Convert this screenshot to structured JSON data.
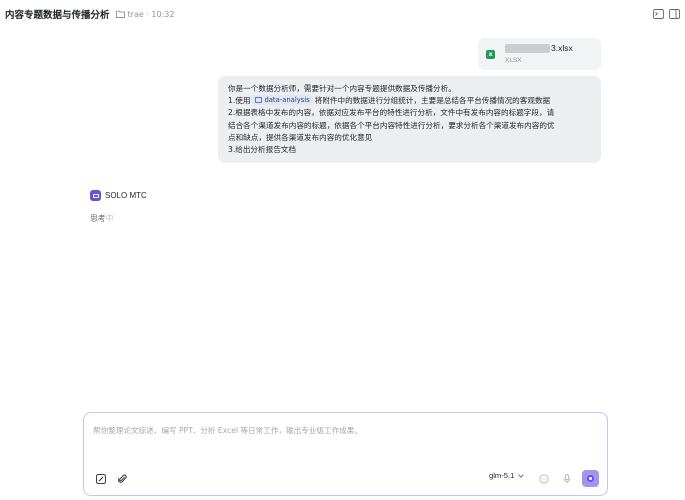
{
  "header": {
    "title": "内容专题数据与传播分析",
    "project": "trae",
    "time": "10:32",
    "project_meta": "trae · 10:32"
  },
  "attachment": {
    "name": "3.xlsx",
    "type": "XLSX",
    "icon": "excel-file-icon"
  },
  "user_message": {
    "line1": "你是一个数据分析师，需要针对一个内容专题提供数据及传播分析。",
    "line2_prefix": "1.使用",
    "skill_chip": "data-analysis",
    "line2_suffix": "将附件中的数据进行分组统计，主要是总结各平台传播情况的客观数据",
    "line3": "2.根据表格中发布的内容，依据对应发布平台的特性进行分析，文件中有发布内容的标题字段，请",
    "line4": "结合各个渠道发布内容的标题，依据各个平台内容特性进行分析，要求分析各个渠道发布内容的优",
    "line5": "点和缺点，提供各渠道发布内容的优化意见",
    "line6": "3.给出分析报告文档"
  },
  "assistant": {
    "name": "SOLO MTC",
    "status_main": "思考",
    "status_dim": "中"
  },
  "composer": {
    "placeholder": "帮你整理论文综述、编写 PPT、分析 Excel 等日常工作，输出专业级工作成果。",
    "model": "glm-5.1"
  },
  "colors": {
    "accent": "#6b4fd8",
    "send_bg": "#a394f0",
    "composer_border": "#c9c2f2",
    "bubble_bg": "#eceef1",
    "excel_green": "#1f9d55"
  }
}
